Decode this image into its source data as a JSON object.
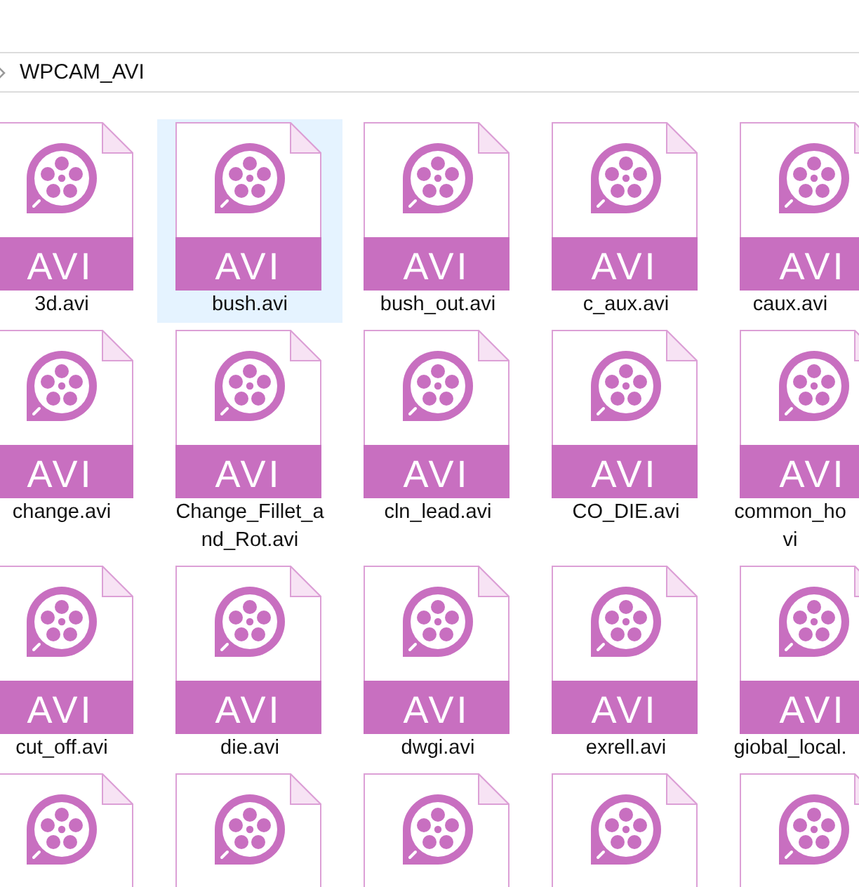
{
  "breadcrumb": {
    "folder": "WPCAM_AVI"
  },
  "files": [
    {
      "lines": [
        "3d.avi"
      ],
      "type_label": "AVI",
      "selected": false
    },
    {
      "lines": [
        "bush.avi"
      ],
      "type_label": "AVI",
      "selected": true
    },
    {
      "lines": [
        "bush_out.avi"
      ],
      "type_label": "AVI",
      "selected": false
    },
    {
      "lines": [
        "c_aux.avi"
      ],
      "type_label": "AVI",
      "selected": false
    },
    {
      "lines": [
        "caux.avi"
      ],
      "type_label": "AVI",
      "selected": false
    },
    {
      "lines": [
        "change.avi"
      ],
      "type_label": "AVI",
      "selected": false
    },
    {
      "lines": [
        "Change_Fillet_a",
        "nd_Rot.avi"
      ],
      "type_label": "AVI",
      "selected": false
    },
    {
      "lines": [
        "cln_lead.avi"
      ],
      "type_label": "AVI",
      "selected": false
    },
    {
      "lines": [
        "CO_DIE.avi"
      ],
      "type_label": "AVI",
      "selected": false
    },
    {
      "lines": [
        "common_ho",
        "vi"
      ],
      "type_label": "AVI",
      "selected": false
    },
    {
      "lines": [
        "cut_off.avi"
      ],
      "type_label": "AVI",
      "selected": false
    },
    {
      "lines": [
        "die.avi"
      ],
      "type_label": "AVI",
      "selected": false
    },
    {
      "lines": [
        "dwgi.avi"
      ],
      "type_label": "AVI",
      "selected": false
    },
    {
      "lines": [
        "exrell.avi"
      ],
      "type_label": "AVI",
      "selected": false
    },
    {
      "lines": [
        "giobal_local."
      ],
      "type_label": "AVI",
      "selected": false
    },
    {
      "selected": false
    },
    {
      "selected": false
    },
    {
      "selected": false
    },
    {
      "selected": false
    },
    {
      "selected": false
    }
  ]
}
